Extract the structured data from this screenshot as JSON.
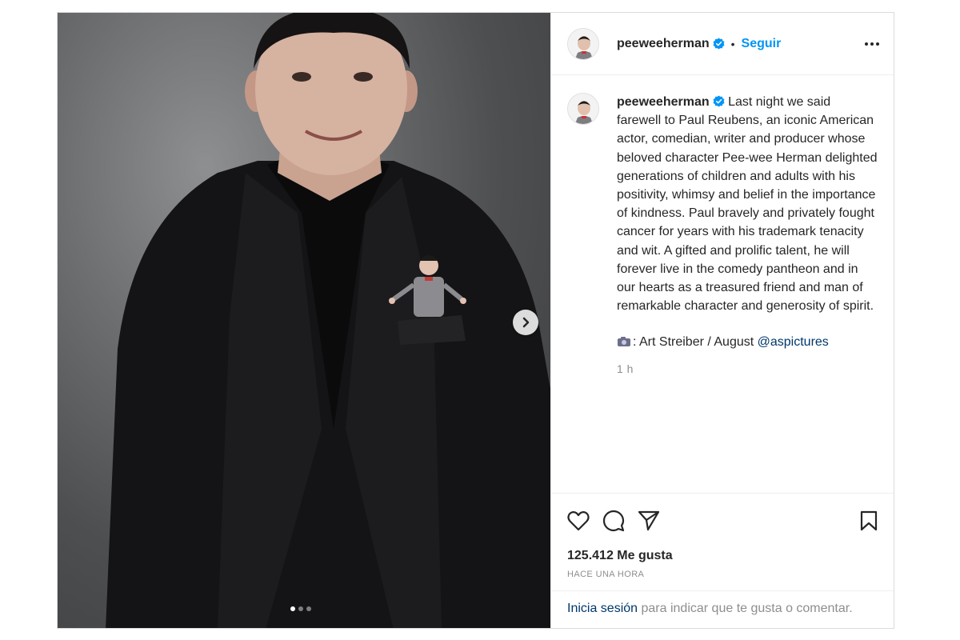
{
  "post": {
    "username": "peeweeherman",
    "follow_label": "Seguir",
    "separator": "•",
    "caption": "Last night we said farewell to Paul Reubens, an iconic American actor, comedian, writer and producer whose beloved character Pee-wee Herman delighted generations of children and adults with his positivity, whimsy and belief in the importance of kindness. Paul bravely and privately fought cancer for years with his trademark tenacity and wit. A gifted and prolific talent, he will forever live in the comedy pantheon and in our hearts as a treasured friend and man of remarkable character and generosity of spirit.",
    "credit_text": ": Art Streiber / August",
    "credit_mention": "@aspictures",
    "time_short": "1 h",
    "likes": "125.412 Me gusta",
    "time_long": "HACE UNA HORA",
    "login_link": "Inicia sesión",
    "login_rest": "para indicar que te gusta o comentar.",
    "carousel": {
      "total": 3,
      "active": 1
    },
    "icons": [
      "verified-badge-icon",
      "more-options-icon",
      "heart-icon",
      "comment-icon",
      "share-icon",
      "bookmark-icon",
      "chevron-right-icon",
      "camera-icon"
    ],
    "colors": {
      "verified": "#0095f6",
      "follow": "#0095f6",
      "link": "#00376b",
      "muted": "#8e8e8e"
    }
  }
}
